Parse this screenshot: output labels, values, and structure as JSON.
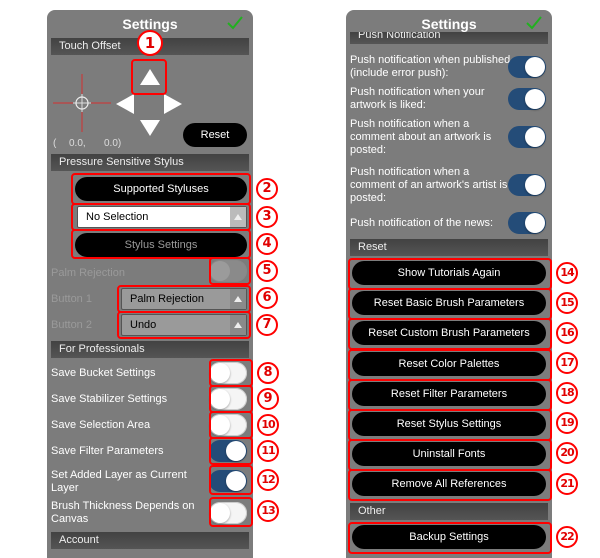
{
  "left_panel": {
    "title": "Settings",
    "touch_offset": {
      "header": "Touch Offset",
      "coord_open": "(",
      "x": "0.0,",
      "y": "0.0)",
      "reset_label": "Reset"
    },
    "stylus": {
      "header": "Pressure Sensitive Stylus",
      "supported_label": "Supported Styluses",
      "selection_value": "No Selection",
      "settings_label": "Stylus Settings",
      "palm_rejection_label": "Palm Rejection",
      "palm_rejection_on": false,
      "button1_label": "Button 1",
      "button1_value": "Palm Rejection",
      "button2_label": "Button 2",
      "button2_value": "Undo"
    },
    "professionals": {
      "header": "For Professionals",
      "items": [
        {
          "label": "Save Bucket Settings",
          "on": false
        },
        {
          "label": "Save Stabilizer Settings",
          "on": false
        },
        {
          "label": "Save Selection Area",
          "on": false
        },
        {
          "label": "Save Filter Parameters",
          "on": true
        },
        {
          "label": "Set Added Layer as Current Layer",
          "on": true
        },
        {
          "label": "Brush Thickness Depends on Canvas",
          "on": false
        }
      ]
    },
    "account_header": "Account"
  },
  "right_panel": {
    "title": "Settings",
    "push": {
      "header": "Push Notification",
      "items": [
        {
          "label": "Push notification when published (include error push):",
          "on": true
        },
        {
          "label": "Push notification when your artwork is liked:",
          "on": true
        },
        {
          "label": "Push notification when a comment about an artwork is posted:",
          "on": true
        },
        {
          "label": "Push notification when a comment of an artwork's artist is posted:",
          "on": true
        },
        {
          "label": "Push notification of the news:",
          "on": true
        }
      ]
    },
    "reset": {
      "header": "Reset",
      "buttons": [
        "Show Tutorials Again",
        "Reset Basic Brush Parameters",
        "Reset Custom Brush Parameters",
        "Reset Color Palettes",
        "Reset Filter Parameters",
        "Reset Stylus Settings",
        "Uninstall Fonts",
        "Remove All References"
      ]
    },
    "other": {
      "header": "Other",
      "backup_label": "Backup Settings"
    }
  },
  "annotations": [
    "1",
    "2",
    "3",
    "4",
    "5",
    "6",
    "7",
    "8",
    "9",
    "10",
    "11",
    "12",
    "13",
    "14",
    "15",
    "16",
    "17",
    "18",
    "19",
    "20",
    "21",
    "22"
  ],
  "colors": {
    "panel_bg": "#7c7c7c",
    "toggle_on": "#244c78",
    "check_green": "#22b020",
    "callout_red": "#ff0000"
  }
}
